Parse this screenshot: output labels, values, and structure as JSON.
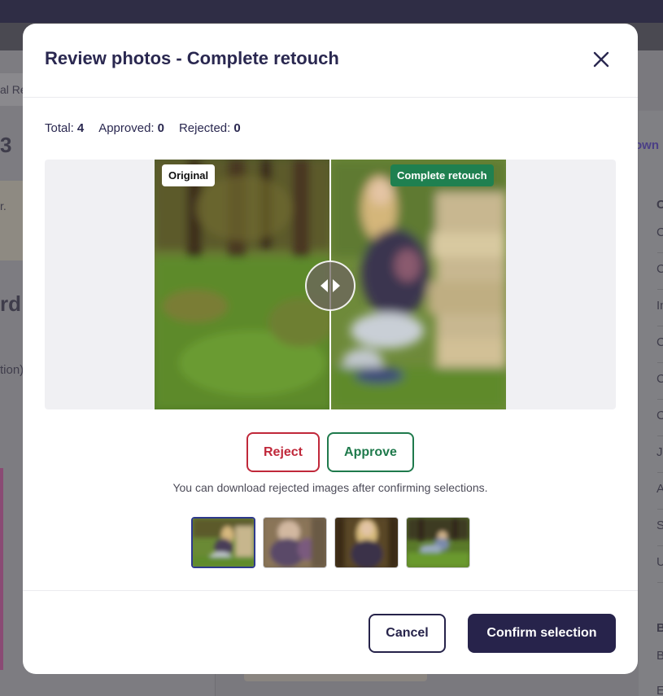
{
  "background": {
    "left_tab_fragment": "al Re",
    "left_heading_fragment": "3",
    "left_card_fragment": "r.",
    "left_title_fragment": "rd",
    "left_subtext_fragment": "tion)",
    "right_link_fragment": "own",
    "right_section_letter": "C",
    "right_list_letters": [
      "C",
      "C",
      "In",
      "C",
      "C",
      "C",
      "J",
      "A",
      "S",
      "U"
    ],
    "right_section_letter_2": "B",
    "right_list_letters_2": [
      "B",
      "E"
    ]
  },
  "modal": {
    "title": "Review photos - Complete retouch",
    "close_icon": "close-icon",
    "stats": {
      "total_label": "Total:",
      "total_value": "4",
      "approved_label": "Approved:",
      "approved_value": "0",
      "rejected_label": "Rejected:",
      "rejected_value": "0"
    },
    "comparison": {
      "left_tag": "Original",
      "right_tag": "Complete retouch",
      "slider_position": 0.5,
      "handle_icon": "left-right-arrows-icon"
    },
    "actions": {
      "reject_label": "Reject",
      "approve_label": "Approve",
      "hint": "You can download rejected images after confirming selections."
    },
    "thumbnails": [
      {
        "name": "photo-1",
        "selected": true
      },
      {
        "name": "photo-2",
        "selected": false
      },
      {
        "name": "photo-3",
        "selected": false
      },
      {
        "name": "photo-4",
        "selected": false
      }
    ],
    "footer": {
      "cancel_label": "Cancel",
      "confirm_label": "Confirm selection"
    }
  },
  "colors": {
    "title": "#2a2850",
    "reject": "#c0283a",
    "approve": "#1f7a4c",
    "retouch_tag": "#1f8050",
    "confirm_bg": "#27234b",
    "selected_thumb_border": "#2e3a8c"
  }
}
